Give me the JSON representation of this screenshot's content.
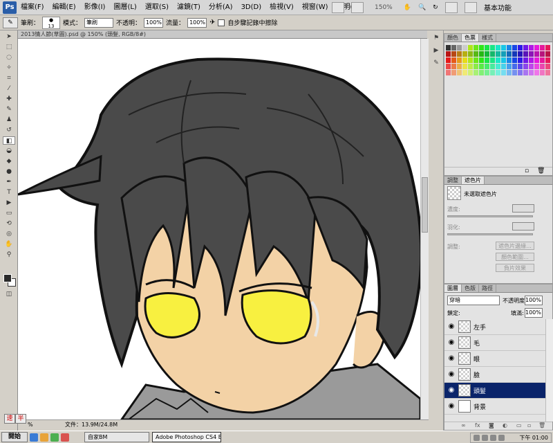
{
  "app": {
    "logo": "Ps"
  },
  "menu": [
    "檔案(F)",
    "編輯(E)",
    "影像(I)",
    "圖層(L)",
    "選取(S)",
    "濾鏡(T)",
    "分析(A)",
    "3D(D)",
    "檢視(V)",
    "視窗(W)",
    "說明(H)"
  ],
  "menubar": {
    "zoom": "150%",
    "workspace": "基本功能"
  },
  "options": {
    "brush_label": "筆刷：",
    "brush_size": "13",
    "mode_label": "模式：",
    "mode_value": "筆刷",
    "opacity_label": "不透明：",
    "opacity_value": "100%",
    "flow_label": "流量：",
    "flow_value": "100%",
    "history_label": "自步驟記錄中擦除"
  },
  "document": {
    "tab_title": "2013情人節(草圖).psd @ 150% (頭髮, RGB/8#)",
    "zoom": "%",
    "size": "文件：13.9M/24.8M"
  },
  "panels": {
    "swatch_tabs": [
      "顏色",
      "色票",
      "樣式"
    ],
    "mask_tabs": [
      "調整",
      "遮色片"
    ],
    "mask_title": "未選取遮色片",
    "density_label": "濃度:",
    "feather_label": "羽化:",
    "adjust_label": "調整:",
    "mask_buttons": [
      "遮色片邊緣...",
      "顏色範圍...",
      "負片效果"
    ],
    "layer_tabs": [
      "圖層",
      "色版",
      "路徑"
    ],
    "blend_mode": "穿暗",
    "opacity_label": "不透明度:",
    "opacity_value": "100%",
    "lock_label": "鎖定:",
    "fill_label": "填滿:",
    "fill_value": "100%",
    "layers": [
      {
        "name": "左手",
        "active": false
      },
      {
        "name": "毛",
        "active": false
      },
      {
        "name": "眼",
        "active": false
      },
      {
        "name": "臉",
        "active": false
      },
      {
        "name": "頭髮",
        "active": true
      },
      {
        "name": "背景",
        "active": false
      }
    ]
  },
  "ime": [
    "速",
    "半"
  ],
  "taskbar": {
    "start": "開始",
    "apps": [
      "自家BM",
      "Adobe Photoshop CS4 Ex..."
    ],
    "clock": "下午 01:00"
  },
  "colors": {
    "hair": "#4a4a4a",
    "skin": "#f3d2a6",
    "eyes": "#f8f040",
    "scarf": "#9a9a9a",
    "layer_active": "#0a246a"
  }
}
